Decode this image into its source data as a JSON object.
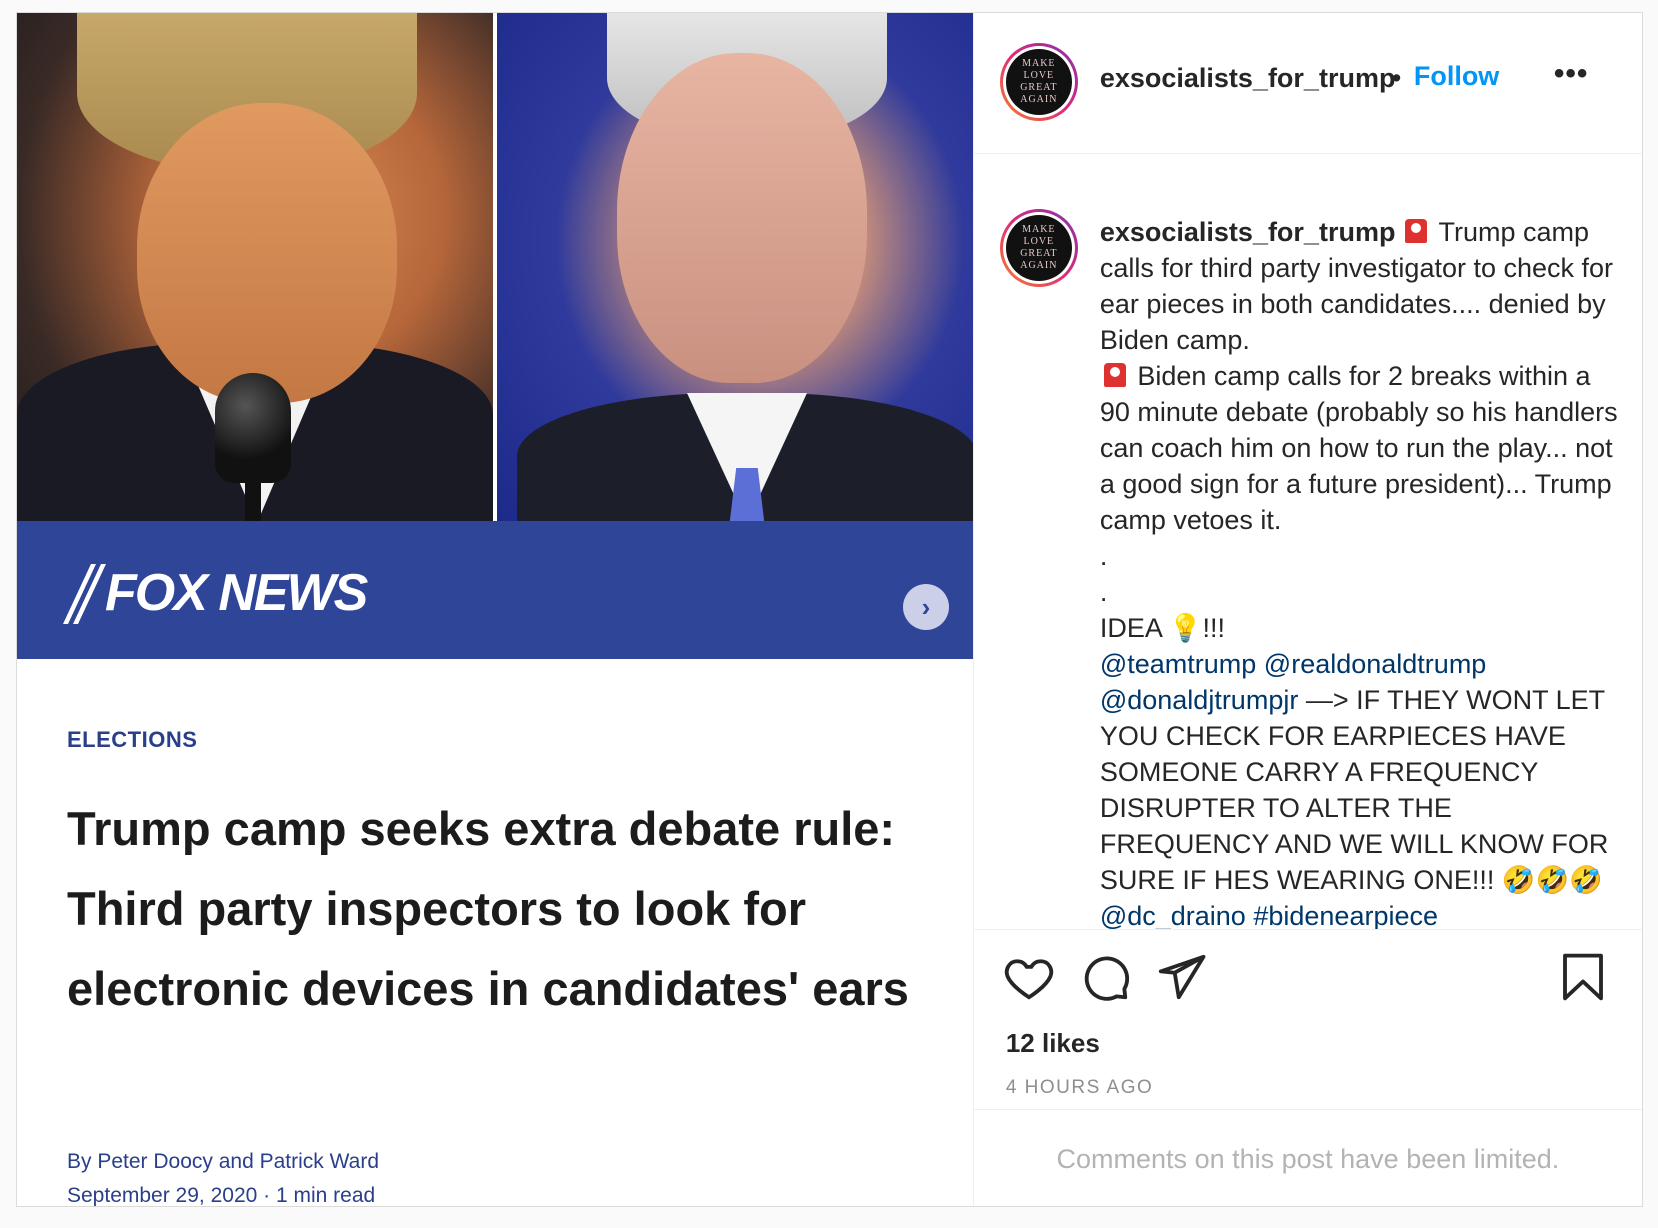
{
  "post": {
    "author": "exsocialists_for_trump",
    "follow_label": "Follow",
    "separator": "•",
    "more_label": "•••",
    "avatar_text": [
      "MAKE",
      "LOVE",
      "GREAT",
      "AGAIN"
    ]
  },
  "media": {
    "brand": "FOX NEWS",
    "next_label": "›",
    "category": "ELECTIONS",
    "headline": "Trump camp seeks extra debate rule: Third party inspectors to look for electronic devices in candidates' ears",
    "byline": "By Peter Doocy and Patrick Ward",
    "dateline": "September 29, 2020 · 1 min read"
  },
  "caption": {
    "username": "exsocialists_for_trump",
    "p1": "Trump camp calls for third party investigator to check for ear pieces in both candidates.... denied by Biden camp.",
    "p2": "Biden camp calls for 2 breaks within a 90 minute debate (probably so his handlers can coach him on how to run the play... not a good sign for a future president)... Trump camp vetoes it.",
    "dot1": ".",
    "dot2": ".",
    "idea_label": "IDEA",
    "idea_suffix": "!!!",
    "mention1": "@teamtrump",
    "mention2": "@realdonaldtrump",
    "mention3": "@donaldjtrumpjr",
    "p3": "—> IF THEY WONT LET YOU CHECK FOR EARPIECES HAVE SOMEONE CARRY A FREQUENCY DISRUPTER TO ALTER THE FREQUENCY AND WE WILL KNOW FOR SURE IF HES WEARING ONE!!! 🤣🤣🤣",
    "mention4": "@dc_draino",
    "hashtag": "#bidenearpiece"
  },
  "stats": {
    "likes": "12 likes",
    "time": "4 HOURS AGO"
  },
  "comments_notice": "Comments on this post have been limited.",
  "colors": {
    "follow": "#0095f6",
    "mention": "#00376b",
    "fox_banner": "#2f4597"
  },
  "icons": [
    "heart-icon",
    "comment-icon",
    "share-icon",
    "bookmark-icon",
    "chevron-right-icon",
    "more-icon",
    "siren-emoji",
    "lightbulb-emoji"
  ]
}
